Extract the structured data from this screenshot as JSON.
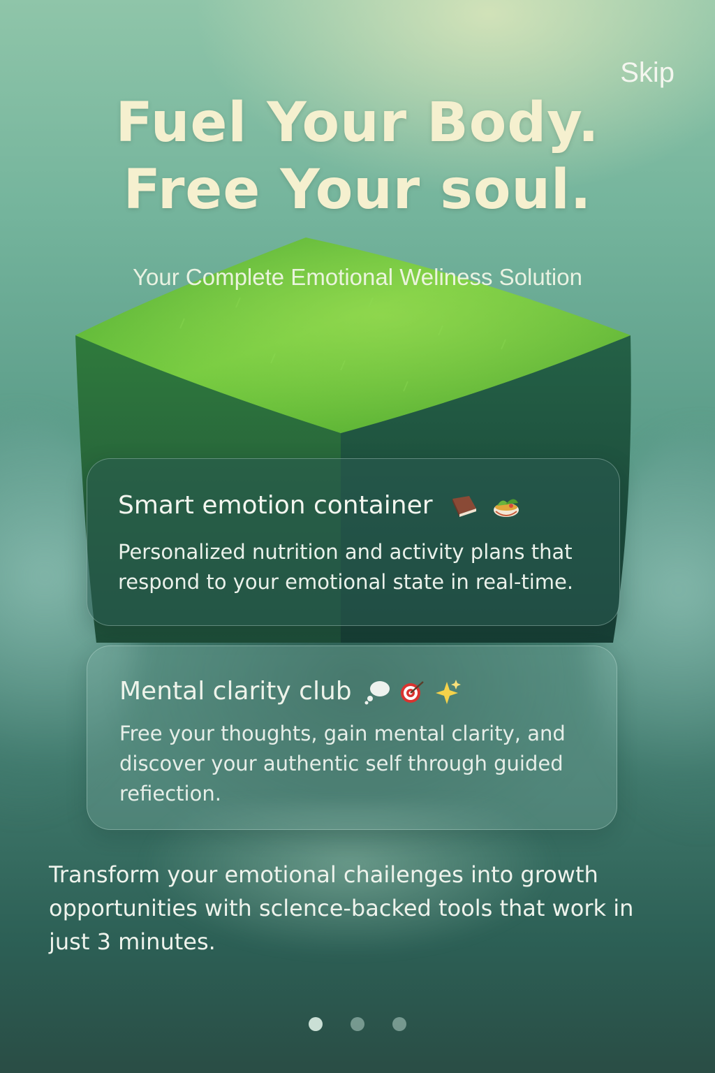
{
  "header": {
    "skip_label": "Skip"
  },
  "hero": {
    "headline_line1": "Fuel Your Body.",
    "headline_line2": "Free Your soul.",
    "subtitle": "Your Complete Emotional Weliness Solution"
  },
  "features": [
    {
      "title": "Smart emotion container",
      "description": "Personalized nutrition and activity plans that respond to your emotional state in real-time.",
      "icons": [
        "book-icon",
        "salad-bowl-icon"
      ]
    },
    {
      "title": "Mental clarity club",
      "description": "Free your thoughts, gain mental clarity, and discover your authentic self through guided refiection.",
      "icons": [
        "thought-bubble-icon",
        "target-icon",
        "sparkles-icon"
      ]
    }
  ],
  "footer": {
    "text": "Transform your emotional chailenges into growth opportunities with sclence-backed tools that work in just 3 minutes."
  },
  "pagination": {
    "page_count": 3,
    "active_index": 0
  },
  "colors": {
    "background_top": "#8fc5a9",
    "background_bottom": "#2a4d45",
    "headline": "#f5f0cf",
    "grass": "#6cc43a"
  }
}
